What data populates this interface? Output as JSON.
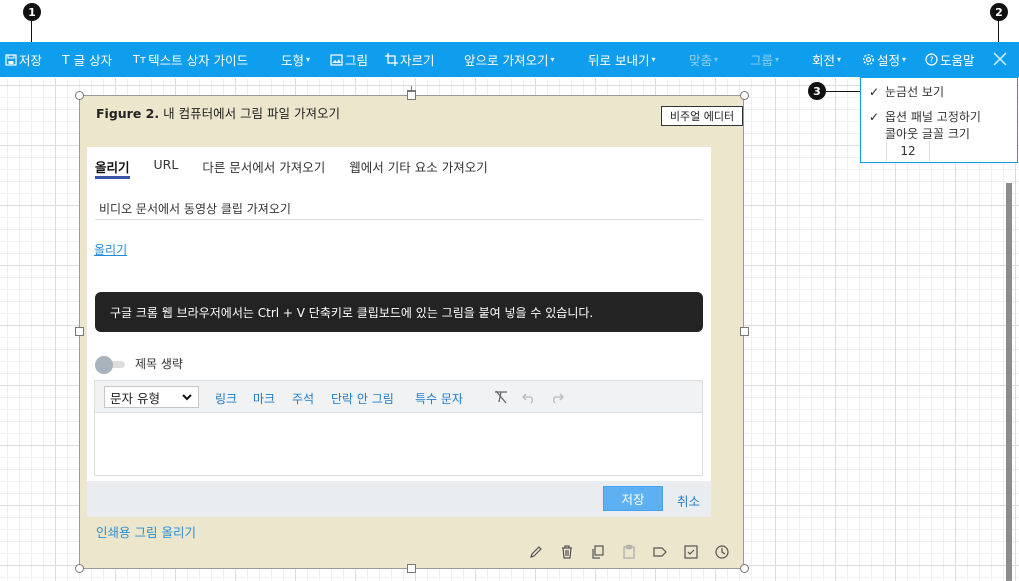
{
  "callouts": [
    "1",
    "2",
    "3"
  ],
  "toolbar": {
    "save": "저장",
    "text": "글 상자",
    "text_guide": "텍스트 상자 가이드",
    "shape": "도형",
    "image": "그림",
    "crop": "자르기",
    "bring_forward": "앞으로 가져오기",
    "send_backward": "뒤로 보내기",
    "align": "맞춤",
    "group": "그룹",
    "rotate": "회전",
    "settings": "설정",
    "help": "도움말",
    "text_prefix": "T",
    "text_guide_prefix": "Tт"
  },
  "settings_menu": {
    "show_grid": "눈금선 보기",
    "pin_options": "옵션 패널 고정하기",
    "callout_font_size": "콜아웃 글꼴 크기",
    "font_size_value": "12"
  },
  "figure": {
    "label": "Figure 2.",
    "title": "내 컴퓨터에서 그림 파일 가져오기",
    "visual_editor": "비주얼 에디터",
    "print_link": "인쇄용 그림 올리기"
  },
  "dialog": {
    "tabs": [
      {
        "label": "올리기",
        "active": true
      },
      {
        "label": "URL",
        "active": false
      },
      {
        "label": "다른 문서에서 가져오기",
        "active": false
      },
      {
        "label": "웹에서 기타 요소 가져오기",
        "active": false
      }
    ],
    "subtitle": "비디오 문서에서 동영상 클립 가져오기",
    "upload_link": "올리기",
    "tooltip": "구글 크롬 웹 브라우저에서는 Ctrl + V 단축키로 클립보드에 있는 그림을 붙여 넣을 수 있습니다.",
    "omit_caption": "제목 생략",
    "editor": {
      "format_select": "문자 유형",
      "link": "링크",
      "mark": "마크",
      "note": "주석",
      "no_break_image": "단락 안 그림",
      "special_char": "특수 문자"
    },
    "save": "저장",
    "cancel": "취소"
  },
  "colors": {
    "toolbar_bg": "#0f9ded",
    "panel_bg": "#ebe6cc",
    "link": "#1f7bc8",
    "save_button": "#5db0f2"
  }
}
